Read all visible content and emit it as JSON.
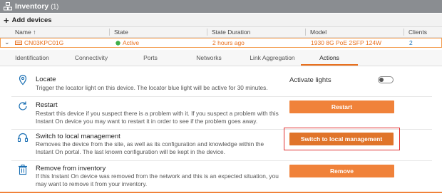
{
  "header": {
    "title": "Inventory",
    "count": "(1)"
  },
  "toolbar": {
    "add_label": "Add devices"
  },
  "table": {
    "columns": {
      "name": "Name",
      "sort": "↑",
      "state": "State",
      "duration": "State Duration",
      "model": "Model",
      "clients": "Clients"
    },
    "row": {
      "expand": "⌄",
      "name": "CN03KPC01G",
      "state": "Active",
      "duration": "2 hours ago",
      "model": "1930 8G PoE 2SFP 124W",
      "clients": "2"
    }
  },
  "tabs": [
    "Identification",
    "Connectivity",
    "Ports",
    "Networks",
    "Link Aggregation",
    "Actions"
  ],
  "actions": {
    "locate": {
      "title": "Locate",
      "desc": "Trigger the locator light on this device. The locator blue light will be active for 30 minutes.",
      "toggle_label": "Activate lights"
    },
    "restart": {
      "title": "Restart",
      "desc": "Restart this device if you suspect there is a problem with it. If you suspect a problem with this Instant On device you may want to restart it in order to see if the problem goes away.",
      "button": "Restart"
    },
    "local": {
      "title": "Switch to local management",
      "desc": "Removes the device from the site, as well as its configuration and knowledge within the Instant On portal. The last known configuration will be kept in the device.",
      "button": "Switch to local management"
    },
    "remove": {
      "title": "Remove from inventory",
      "desc": "If this Instant On device was removed from the network and this is an expected situation, you may want to remove it from your inventory.",
      "button": "Remove"
    }
  },
  "colors": {
    "accent": "#f0823a",
    "active": "#3fae49",
    "link": "#1a6fb3",
    "highlight": "#e03030"
  }
}
